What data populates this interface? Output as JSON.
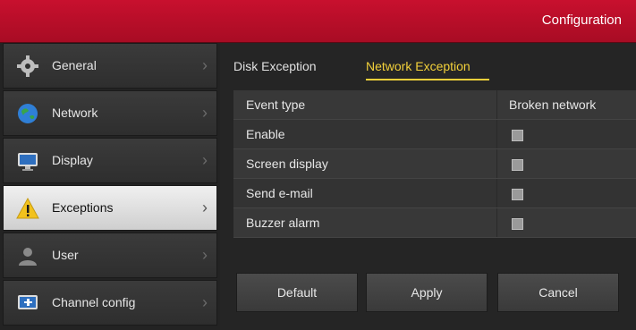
{
  "header": {
    "title": "Configuration"
  },
  "sidebar": {
    "items": [
      {
        "label": "General",
        "icon": "gear-icon"
      },
      {
        "label": "Network",
        "icon": "globe-icon"
      },
      {
        "label": "Display",
        "icon": "monitor-icon"
      },
      {
        "label": "Exceptions",
        "icon": "warning-icon",
        "active": true
      },
      {
        "label": "User",
        "icon": "user-icon"
      },
      {
        "label": "Channel config",
        "icon": "channel-config-icon"
      }
    ]
  },
  "tabs": [
    {
      "label": "Disk Exception"
    },
    {
      "label": "Network Exception",
      "active": true
    }
  ],
  "table": {
    "rows": [
      {
        "label": "Event type",
        "value": "Broken network"
      },
      {
        "label": "Enable",
        "checked": false
      },
      {
        "label": "Screen display",
        "checked": false
      },
      {
        "label": "Send e-mail",
        "checked": false
      },
      {
        "label": "Buzzer alarm",
        "checked": false
      }
    ]
  },
  "buttons": {
    "default_label": "Default",
    "apply_label": "Apply",
    "cancel_label": "Cancel"
  },
  "colors": {
    "brand": "#c8102e",
    "accent": "#f2d03a",
    "active_sidebar": "#e6e6e6"
  }
}
